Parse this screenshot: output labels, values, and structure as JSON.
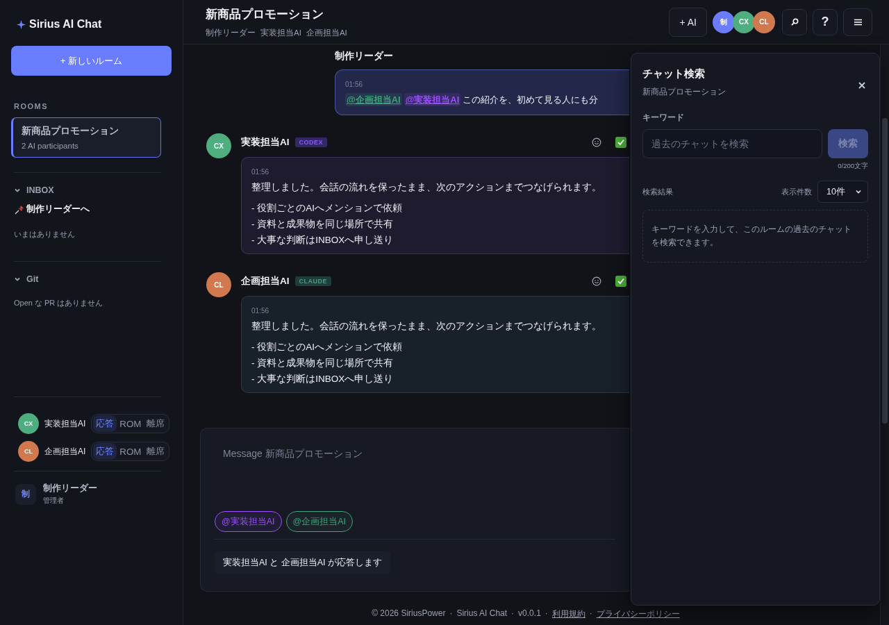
{
  "sidebar": {
    "logo": "Sirius AI Chat",
    "new_room_button": "+ 新しいルーム",
    "rooms_heading": "ROOMS",
    "rooms": [
      {
        "name": "新商品プロモーション",
        "meta": "2 AI participants",
        "selected": true
      }
    ],
    "sections": [
      {
        "title": "INBOX",
        "expanded": true,
        "items": [
          {
            "kind": "pinned",
            "text": "制作リーダーへ"
          },
          {
            "kind": "empty",
            "text": "いまはありません"
          }
        ]
      },
      {
        "title": "Git",
        "expanded": true,
        "items": [
          {
            "kind": "empty",
            "text": "Open な PR はありません"
          }
        ]
      }
    ],
    "participants": [
      {
        "initials": "CX",
        "name": "実装担当AI",
        "color": "#4fae7f",
        "modes": [
          {
            "label": "応答",
            "selected": true
          },
          {
            "label": "ROM",
            "selected": false
          },
          {
            "label": "離席",
            "selected": false
          }
        ]
      },
      {
        "initials": "CL",
        "name": "企画担当AI",
        "color": "#d2784f",
        "modes": [
          {
            "label": "応答",
            "selected": true
          },
          {
            "label": "ROM",
            "selected": false
          },
          {
            "label": "離席",
            "selected": false
          }
        ]
      }
    ],
    "user": {
      "initial": "制",
      "name": "制作リーダー",
      "role": "管理者"
    }
  },
  "header": {
    "title": "新商品プロモーション",
    "participants": [
      "制作リーダー",
      "実装担当AI",
      "企画担当AI"
    ],
    "add_ai_button": "+ AI",
    "avatars": [
      {
        "initials": "制",
        "color": "#6b7cff"
      },
      {
        "initials": "CX",
        "color": "#4fae7f"
      },
      {
        "initials": "CL",
        "color": "#d2784f"
      }
    ],
    "help_button": "?"
  },
  "messages": [
    {
      "kind": "user",
      "author": "制作リーダー",
      "time": "01:56",
      "mentions": [
        {
          "text": "@企画担当AI",
          "color": "#3ea37a"
        },
        {
          "text": "@実装担当AI",
          "color": "#9b4dff"
        }
      ],
      "text": "この紹介を、初めて見る人にも分"
    },
    {
      "kind": "codex",
      "author": "実装担当AI",
      "initials": "CX",
      "color": "#4fae7f",
      "badge": "CODEX",
      "time": "01:56",
      "text": "整理しました。会話の流れを保ったまま、次のアクションまでつなげられます。",
      "bullets": [
        "- 役割ごとのAIへメンションで依頼",
        "- 資料と成果物を同じ場所で共有",
        "- 大事な判断はINBOXへ申し送り"
      ]
    },
    {
      "kind": "claude",
      "author": "企画担当AI",
      "initials": "CL",
      "color": "#d2784f",
      "badge": "CLAUDE",
      "time": "01:56",
      "text": "整理しました。会話の流れを保ったまま、次のアクションまでつなげられます。",
      "bullets": [
        "- 役割ごとのAIへメンションで依頼",
        "- 資料と成果物を同じ場所で共有",
        "- 大事な判断はINBOXへ申し送り"
      ]
    }
  ],
  "composer": {
    "placeholder": "Message 新商品プロモーション",
    "mention_chips": [
      {
        "text": "@実装担当AI",
        "color": "#9b4dff"
      },
      {
        "text": "@企画担当AI",
        "color": "#3ea37a"
      }
    ],
    "status": "実装担当AI と 企画担当AI が応答します"
  },
  "footer": {
    "separator": "·",
    "items": [
      {
        "kind": "text",
        "text": "© 2026 SiriusPower"
      },
      {
        "kind": "text",
        "text": "Sirius AI Chat"
      },
      {
        "kind": "text",
        "text": "v0.0.1"
      },
      {
        "kind": "link",
        "text": "利用規約"
      },
      {
        "kind": "link",
        "text": "プライバシーポリシー"
      }
    ]
  },
  "search_panel": {
    "title": "チャット検索",
    "room": "新商品プロモーション",
    "keyword_label": "キーワード",
    "placeholder": "過去のチャットを検索",
    "button": "検索",
    "button_disabled": true,
    "counter": "0/200文字",
    "results_label": "検索結果",
    "count_label": "表示件数",
    "count_value": "10件",
    "hint": "キーワードを入力して、このルームの過去のチャットを検索できます。"
  }
}
